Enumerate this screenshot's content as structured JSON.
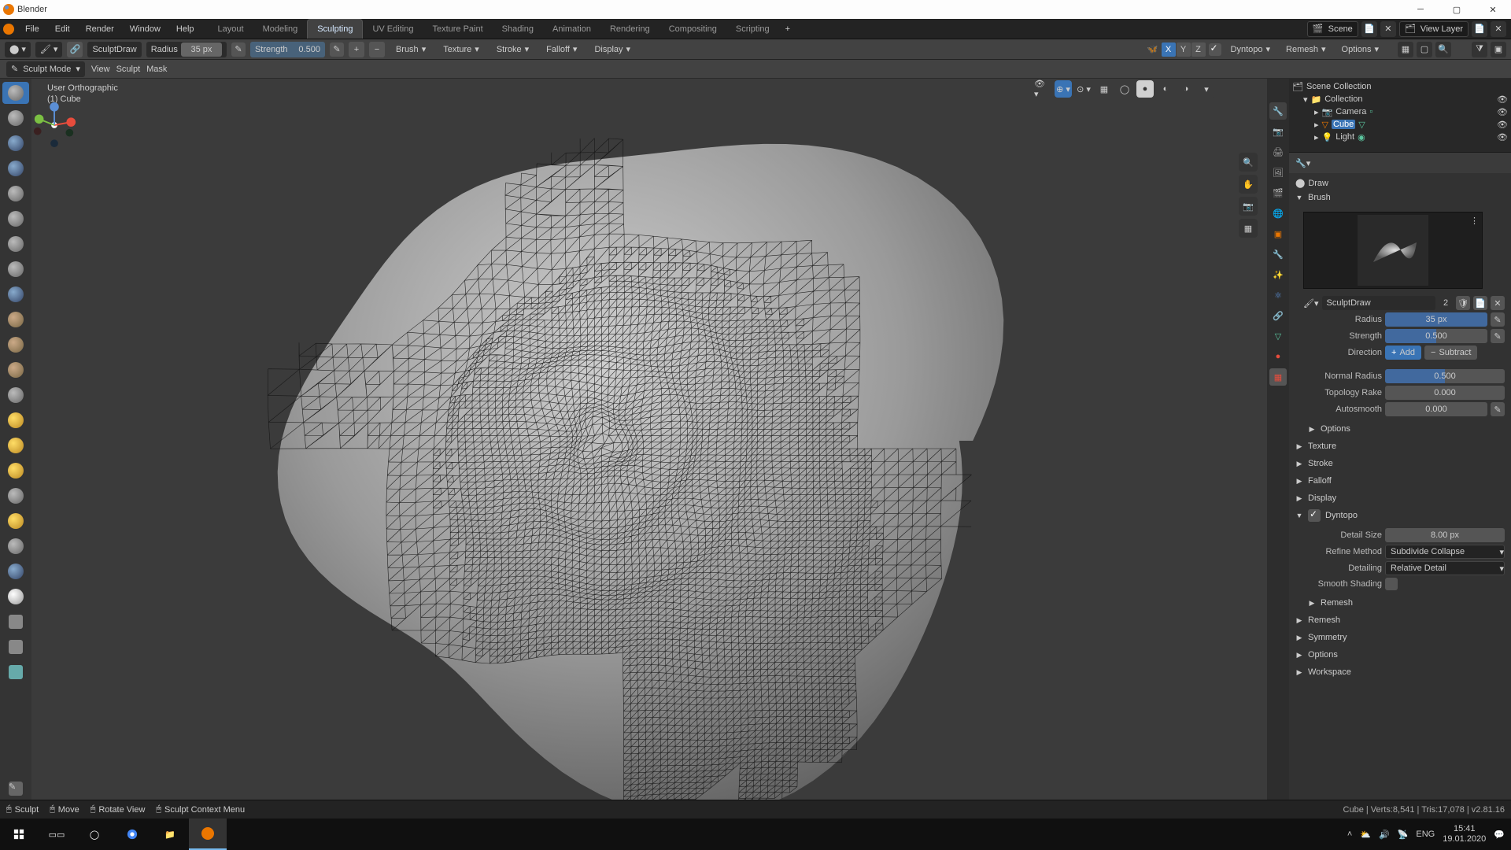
{
  "app": {
    "title": "Blender"
  },
  "menu": {
    "items": [
      "File",
      "Edit",
      "Render",
      "Window",
      "Help"
    ]
  },
  "workspaces": {
    "tabs": [
      "Layout",
      "Modeling",
      "Sculpting",
      "UV Editing",
      "Texture Paint",
      "Shading",
      "Animation",
      "Rendering",
      "Compositing",
      "Scripting"
    ],
    "active": "Sculpting",
    "add": "+"
  },
  "scene": {
    "label": "Scene",
    "viewlayer": "View Layer"
  },
  "toolbar": {
    "brush_name": "SculptDraw",
    "radius_label": "Radius",
    "radius_value": "35 px",
    "strength_label": "Strength",
    "strength_value": "0.500",
    "mirror_label": "",
    "x": "X",
    "y": "Y",
    "z": "Z",
    "dyntopo": "Dyntopo",
    "remesh": "Remesh",
    "options": "Options",
    "brush_menu": "Brush",
    "texture_menu": "Texture",
    "stroke_menu": "Stroke",
    "falloff_menu": "Falloff",
    "display_menu": "Display",
    "plus": "+"
  },
  "header2": {
    "mode": "Sculpt Mode",
    "items": [
      "View",
      "Sculpt",
      "Mask"
    ]
  },
  "viewport": {
    "projection": "User Orthographic",
    "object": "(1) Cube"
  },
  "outliner": {
    "root": "Scene Collection",
    "collection": "Collection",
    "items": [
      {
        "name": "Camera",
        "type": "camera"
      },
      {
        "name": "Cube",
        "type": "mesh",
        "selected": true
      },
      {
        "name": "Light",
        "type": "light"
      }
    ]
  },
  "props": {
    "draw_label": "Draw",
    "brush_header": "Brush",
    "brush_name": "SculptDraw",
    "brush_users": "2",
    "radius_label": "Radius",
    "radius": "35 px",
    "strength_label": "Strength",
    "strength": "0.500",
    "direction_label": "Direction",
    "dir_add": "Add",
    "dir_sub": "Subtract",
    "normal_radius_label": "Normal Radius",
    "normal_radius": "0.500",
    "topology_rake_label": "Topology Rake",
    "topology_rake": "0.000",
    "autosmooth_label": "Autosmooth",
    "autosmooth": "0.000",
    "sections": {
      "options": "Options",
      "texture": "Texture",
      "stroke": "Stroke",
      "falloff": "Falloff",
      "display": "Display",
      "dyntopo": "Dyntopo",
      "remesh_sub": "Remesh",
      "remesh": "Remesh",
      "symmetry": "Symmetry",
      "options2": "Options",
      "workspace": "Workspace"
    },
    "dyntopo": {
      "detail_size_label": "Detail Size",
      "detail_size": "8.00 px",
      "refine_label": "Refine Method",
      "refine": "Subdivide Collapse",
      "detailing_label": "Detailing",
      "detailing": "Relative Detail",
      "smooth_label": "Smooth Shading"
    }
  },
  "status": {
    "sculpt": "Sculpt",
    "move": "Move",
    "rotate": "Rotate View",
    "menu": "Sculpt Context Menu",
    "stats": "Cube | Verts:8,541 | Tris:17,078 | v2.81.16"
  },
  "taskbar": {
    "lang": "ENG",
    "time": "15:41",
    "date": "19.01.2020"
  }
}
